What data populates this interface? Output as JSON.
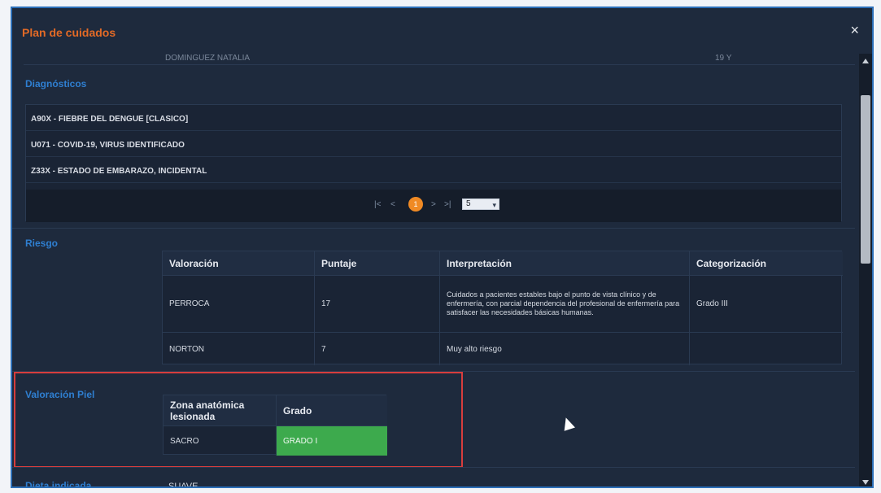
{
  "modal": {
    "title": "Plan de cuidados",
    "close_icon": "×"
  },
  "patient_strip": {
    "left_text": "DOMINGUEZ NATALIA",
    "right_text": "19 Y"
  },
  "diagnosticos": {
    "title": "Diagnósticos",
    "items": [
      "A90X - FIEBRE DEL DENGUE [CLASICO]",
      "U071 - COVID-19, VIRUS IDENTIFICADO",
      "Z33X - ESTADO DE EMBARAZO, INCIDENTAL"
    ],
    "pager": {
      "first": "|<",
      "prev": "<",
      "page": "1",
      "next": ">",
      "last": ">|",
      "page_size": "5"
    }
  },
  "riesgo": {
    "title": "Riesgo",
    "headers": [
      "Valoración",
      "Puntaje",
      "Interpretación",
      "Categorización"
    ],
    "rows": [
      {
        "valoracion": "PERROCA",
        "puntaje": "17",
        "interpretacion": "Cuidados a pacientes estables bajo el punto de vista clínico y de enfermería, con parcial dependencia del profesional de enfermería para satisfacer las necesidades básicas humanas.",
        "categorizacion": "Grado III"
      },
      {
        "valoracion": "NORTON",
        "puntaje": "7",
        "interpretacion": "Muy alto riesgo",
        "categorizacion": ""
      }
    ]
  },
  "valoracion_piel": {
    "title": "Valoración Piel",
    "headers": [
      "Zona anatómica lesionada",
      "Grado"
    ],
    "rows": [
      {
        "zona": "SACRO",
        "grado": "GRADO I"
      }
    ],
    "grade_color": "#3daa4d"
  },
  "dieta": {
    "title": "Dieta indicada",
    "value": "SUAVE"
  },
  "colors": {
    "background": "#1e2a3d",
    "accent_title": "#e36a26",
    "section_title": "#2f7fd1",
    "highlight_border": "#d73d3d",
    "pager_active": "#f08a24"
  }
}
